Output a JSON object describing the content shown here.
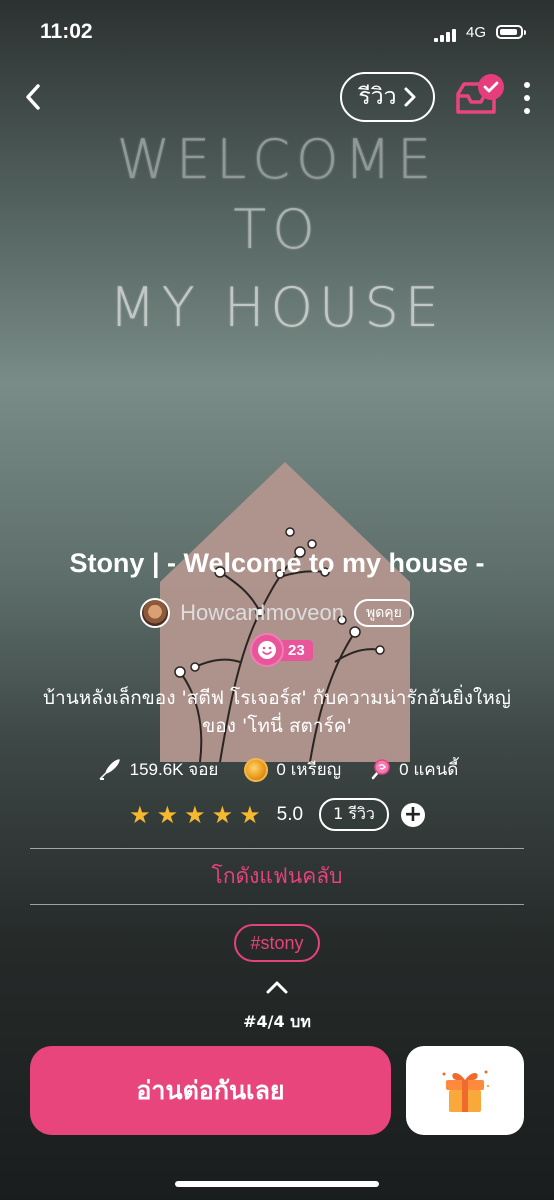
{
  "status_bar": {
    "time": "11:02",
    "network": "4G"
  },
  "top_bar": {
    "review_label": "รีวิว"
  },
  "cover": {
    "line1": "WELCOME",
    "line2": "TO",
    "line3": "MY HOUSE"
  },
  "book": {
    "title": "Stony | - Welcome to my house -",
    "author": "HowcanImoveon",
    "chat_label": "พูดคุย",
    "level": "23",
    "description": "บ้านหลังเล็กของ 'สตีฟ โรเจอร์ส' กับความน่ารักอันยิ่งใหญ่ของ 'โทนี่ สตาร์ค'"
  },
  "stats": {
    "likes": "159.6K จอย",
    "coins": "0 เหรียญ",
    "candy": "0 แคนดี้"
  },
  "rating": {
    "stars": 5,
    "value": "5.0",
    "reviews": "1 รีวิว",
    "add": "+"
  },
  "fanclub_label": "โกดังแฟนคลับ",
  "tag": "#stony",
  "chapters": "#4/4 บท",
  "actions": {
    "read_label": "อ่านต่อกันเลย"
  },
  "colors": {
    "accent": "#e8457c",
    "star": "#f5b82e"
  }
}
